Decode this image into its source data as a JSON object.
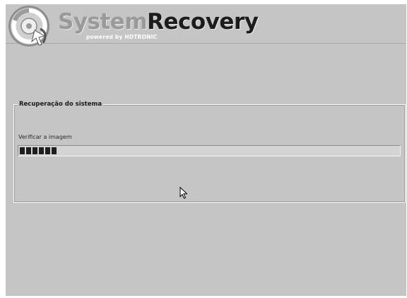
{
  "header": {
    "brand_word1": "System",
    "brand_word2": "Recovery",
    "tagline": "powered by HDTRONIC",
    "logo_icon": "recovery-disc-icon"
  },
  "recovery_panel": {
    "title": "Recuperação do sistema",
    "status_label": "Verificar a imagem",
    "progress_blocks_filled": 6,
    "progress_fraction": 0.1
  },
  "colors": {
    "background": "#c5c5c5",
    "progress_track": "#d4d4d4",
    "progress_fill": "#1e1e1e",
    "brand_dark": "#1c1c1c",
    "brand_light": "#9a9a9a"
  },
  "cursor_icon": "mouse-pointer-icon"
}
